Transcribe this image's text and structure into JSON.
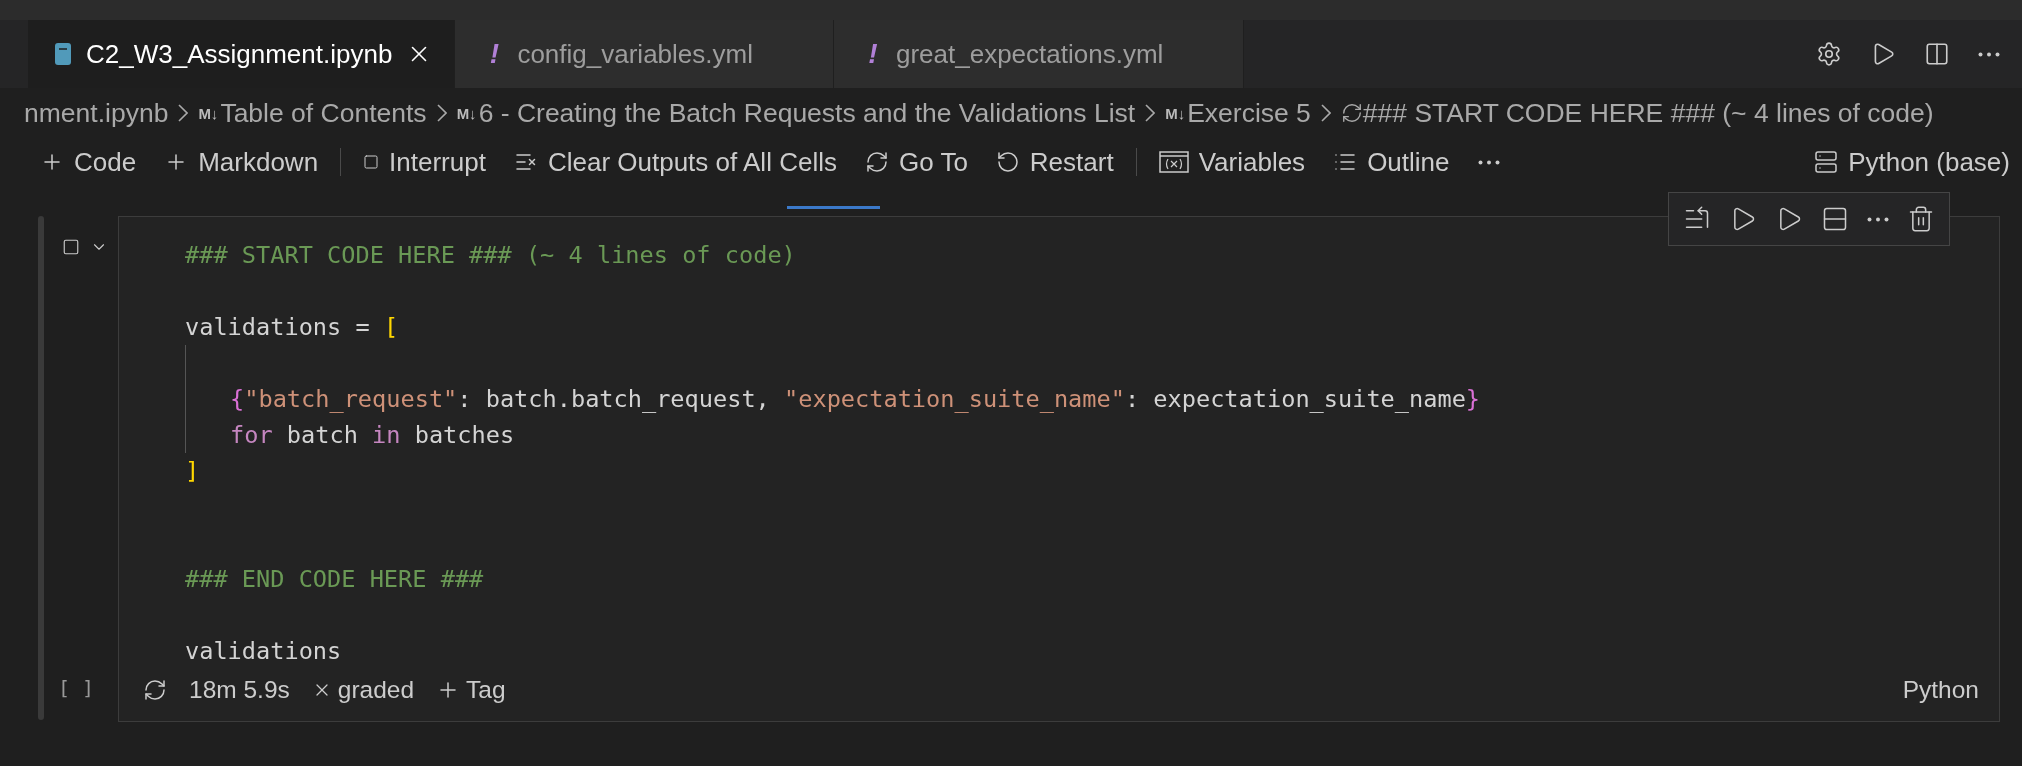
{
  "tabs": [
    {
      "label": "C2_W3_Assignment.ipynb",
      "kind": "notebook",
      "selected": true
    },
    {
      "label": "config_variables.yml",
      "kind": "yaml",
      "glyph": "!",
      "selected": false
    },
    {
      "label": "great_expectations.yml",
      "kind": "yaml",
      "glyph": "!",
      "selected": false
    }
  ],
  "breadcrumbs": [
    {
      "label": "nment.ipynb",
      "kind": "file"
    },
    {
      "label": "Table of Contents",
      "kind": "markdown",
      "glyph": "M↓"
    },
    {
      "label": "6 - Creating the Batch Requests and the Validations List",
      "kind": "markdown",
      "glyph": "M↓"
    },
    {
      "label": "Exercise 5",
      "kind": "markdown",
      "glyph": "M↓"
    },
    {
      "label": "### START CODE HERE ### (~ 4 lines of code)",
      "kind": "code"
    }
  ],
  "toolbar": [
    {
      "label": "Code",
      "kind": "add"
    },
    {
      "label": "Markdown",
      "kind": "add"
    },
    {
      "kind": "divider"
    },
    {
      "label": "Interrupt",
      "kind": "stop"
    },
    {
      "label": "Clear Outputs of All Cells",
      "kind": "clear"
    },
    {
      "label": "Go To",
      "kind": "goto"
    },
    {
      "label": "Restart",
      "kind": "restart"
    },
    {
      "kind": "divider"
    },
    {
      "label": "Variables",
      "kind": "variables"
    },
    {
      "label": "Outline",
      "kind": "outline"
    },
    {
      "kind": "more"
    }
  ],
  "kernel": {
    "label": "Python (base)"
  },
  "cell": {
    "execution_label": "[ ]",
    "duration": "18m 5.9s",
    "tag": "graded",
    "add_tag": "Tag",
    "language": "Python",
    "lines": [
      {
        "kind": "code",
        "tokens": [
          {
            "text": "### START CODE HERE ### (~ 4 lines of code)",
            "kind": "comment"
          }
        ]
      },
      {
        "kind": "blank"
      },
      {
        "kind": "code",
        "tokens": [
          {
            "text": "validations = ",
            "kind": "plain"
          },
          {
            "text": "[",
            "kind": "bracket"
          }
        ]
      },
      {
        "kind": "blank"
      },
      {
        "kind": "code",
        "indented": true,
        "tokens": [
          {
            "text": "{",
            "kind": "brace"
          },
          {
            "text": "\"batch_request\"",
            "kind": "string"
          },
          {
            "text": ": batch.batch_request, ",
            "kind": "plain"
          },
          {
            "text": "\"expectation_suite_name\"",
            "kind": "string"
          },
          {
            "text": ": expectation_suite_name",
            "kind": "plain"
          },
          {
            "text": "}",
            "kind": "brace"
          }
        ]
      },
      {
        "kind": "code",
        "indented": true,
        "tokens": [
          {
            "text": "for",
            "kind": "keyword"
          },
          {
            "text": " batch ",
            "kind": "plain"
          },
          {
            "text": "in",
            "kind": "keyword"
          },
          {
            "text": " batches",
            "kind": "plain"
          }
        ]
      },
      {
        "kind": "code",
        "tokens": [
          {
            "text": "]",
            "kind": "bracket"
          }
        ]
      },
      {
        "kind": "blank"
      },
      {
        "kind": "blank"
      },
      {
        "kind": "code",
        "tokens": [
          {
            "text": "### END CODE HERE ###",
            "kind": "comment"
          }
        ]
      },
      {
        "kind": "blank"
      },
      {
        "kind": "code",
        "tokens": [
          {
            "text": "validations",
            "kind": "plain"
          }
        ]
      }
    ]
  }
}
